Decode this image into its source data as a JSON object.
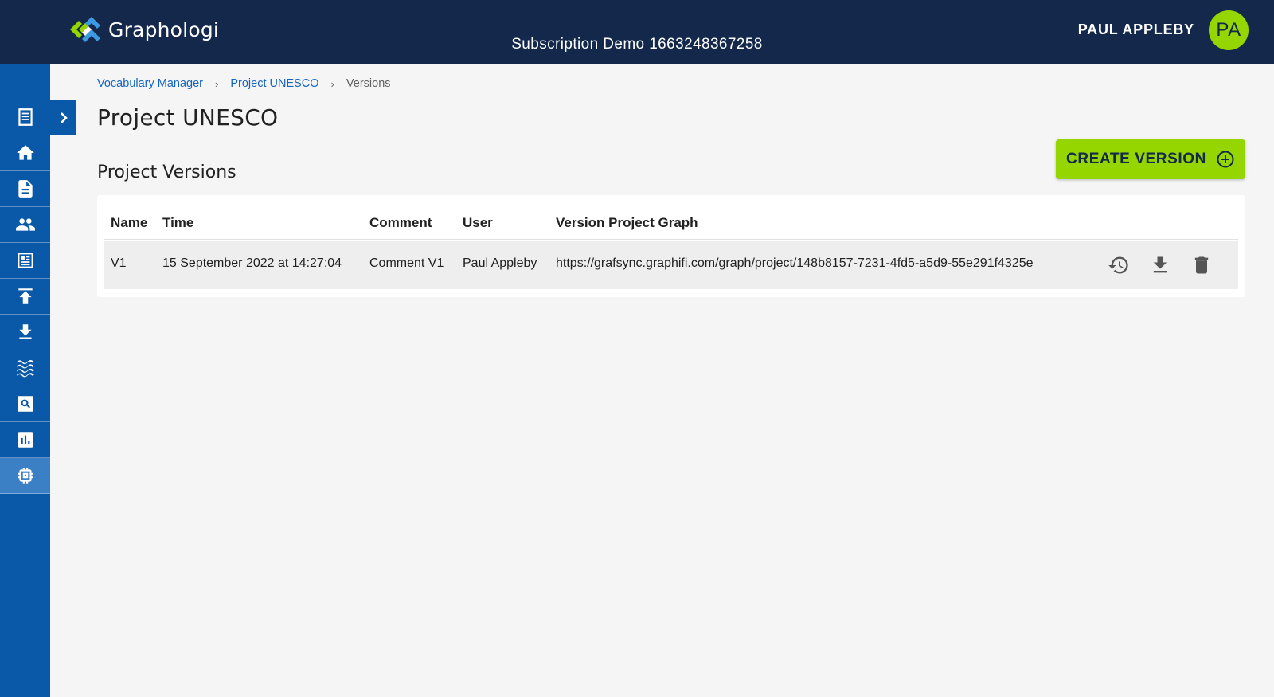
{
  "header": {
    "app_name": "Graphologi",
    "subscription": "Subscription Demo 1663248367258",
    "user_name": "PAUL APPLEBY",
    "user_initials": "PA"
  },
  "sidebar": {
    "items": [
      {
        "icon": "document-lines-icon"
      },
      {
        "icon": "home-icon"
      },
      {
        "icon": "file-icon"
      },
      {
        "icon": "people-icon"
      },
      {
        "icon": "dashboard-icon"
      },
      {
        "icon": "upload-icon"
      },
      {
        "icon": "download-icon"
      },
      {
        "icon": "waves-icon"
      },
      {
        "icon": "search-icon"
      },
      {
        "icon": "chart-icon"
      },
      {
        "icon": "chip-icon",
        "active": true
      }
    ]
  },
  "breadcrumb": {
    "items": [
      "Vocabulary Manager",
      "Project UNESCO"
    ],
    "current": "Versions"
  },
  "page": {
    "title": "Project UNESCO",
    "section_title": "Project Versions",
    "create_button": "CREATE VERSION"
  },
  "table": {
    "columns": [
      "Name",
      "Time",
      "Comment",
      "User",
      "Version Project Graph"
    ],
    "rows": [
      {
        "name": "V1",
        "time": "15 September 2022 at 14:27:04",
        "comment": "Comment V1",
        "user": "Paul Appleby",
        "graph": "https://grafsync.graphifi.com/graph/project/148b8157-7231-4fd5-a5d9-55e291f4325e",
        "actions": [
          "restore-history-icon",
          "download-icon",
          "delete-icon"
        ]
      }
    ]
  },
  "colors": {
    "topbar": "#13284b",
    "sidebar": "#0a58a8",
    "accent": "#95d500",
    "link": "#1565c0"
  }
}
